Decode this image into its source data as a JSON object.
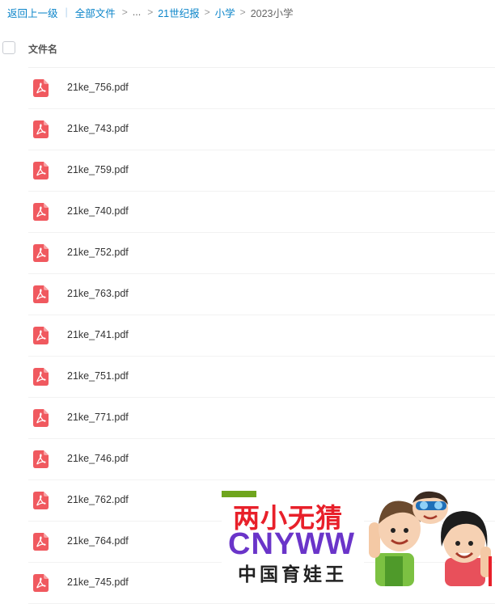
{
  "breadcrumb": {
    "back_label": "返回上一级",
    "all_files_label": "全部文件",
    "ellipsis_label": "...",
    "crumb1_label": "21世纪报",
    "crumb2_label": "小学",
    "current_label": "2023小学",
    "separator_char": ">",
    "divider_char": "|"
  },
  "list": {
    "column_name_label": "文件名",
    "files": [
      {
        "name": "21ke_756.pdf"
      },
      {
        "name": "21ke_743.pdf"
      },
      {
        "name": "21ke_759.pdf"
      },
      {
        "name": "21ke_740.pdf"
      },
      {
        "name": "21ke_752.pdf"
      },
      {
        "name": "21ke_763.pdf"
      },
      {
        "name": "21ke_741.pdf"
      },
      {
        "name": "21ke_751.pdf"
      },
      {
        "name": "21ke_771.pdf"
      },
      {
        "name": "21ke_746.pdf"
      },
      {
        "name": "21ke_762.pdf"
      },
      {
        "name": "21ke_764.pdf"
      },
      {
        "name": "21ke_745.pdf"
      }
    ]
  },
  "watermark": {
    "cn_title": "两小无猜",
    "en_title": "CNYWW",
    "sub_title": "中国育娃王"
  },
  "colors": {
    "link_blue": "#0a84c9",
    "pdf_red": "#f0595f",
    "logo_red": "#e8202a",
    "logo_purple": "#6a34c9",
    "logo_green": "#6fa51d"
  },
  "icons": {
    "file_icon": "pdf-icon",
    "mascots": "two-children-mascot-icon"
  }
}
